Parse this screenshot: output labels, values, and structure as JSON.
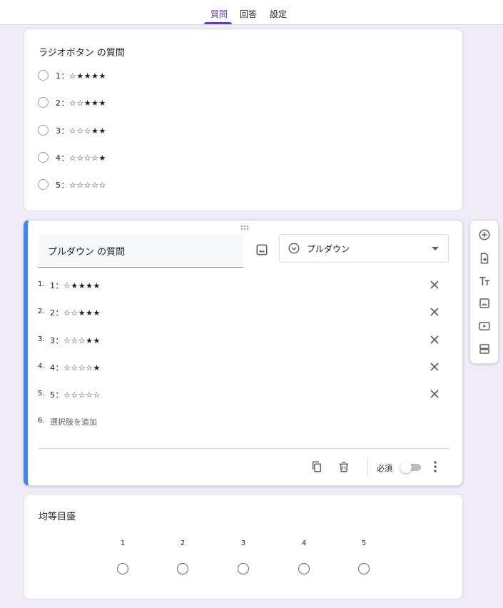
{
  "tabs": [
    {
      "label": "質問",
      "active": true
    },
    {
      "label": "回答",
      "active": false
    },
    {
      "label": "設定",
      "active": false
    }
  ],
  "radio_question": {
    "title": "ラジオボタン の質問",
    "options": [
      "1：☆★★★★",
      "2：☆☆★★★",
      "3：☆☆☆★★",
      "4：☆☆☆☆★",
      "5：☆☆☆☆☆"
    ]
  },
  "dropdown_question": {
    "title": "プルダウン の質問",
    "type_label": "プルダウン",
    "options": [
      {
        "num": "1.",
        "label": "1：☆★★★★"
      },
      {
        "num": "2.",
        "label": "2：☆☆★★★"
      },
      {
        "num": "3.",
        "label": "3：☆☆☆★★"
      },
      {
        "num": "4.",
        "label": "4：☆☆☆☆★"
      },
      {
        "num": "5.",
        "label": "5：☆☆☆☆☆"
      }
    ],
    "add_num": "6.",
    "add_label": "選択肢を追加",
    "required_label": "必須",
    "required": false
  },
  "scale_question": {
    "title": "均等目盛",
    "values": [
      "1",
      "2",
      "3",
      "4",
      "5"
    ]
  },
  "sidebar_tools": [
    "add-question-icon",
    "import-questions-icon",
    "add-title-icon",
    "add-image-icon",
    "add-video-icon",
    "add-section-icon"
  ],
  "colors": {
    "accent": "#673ab7",
    "active_border": "#4285f4",
    "background": "#f0ebf8"
  }
}
